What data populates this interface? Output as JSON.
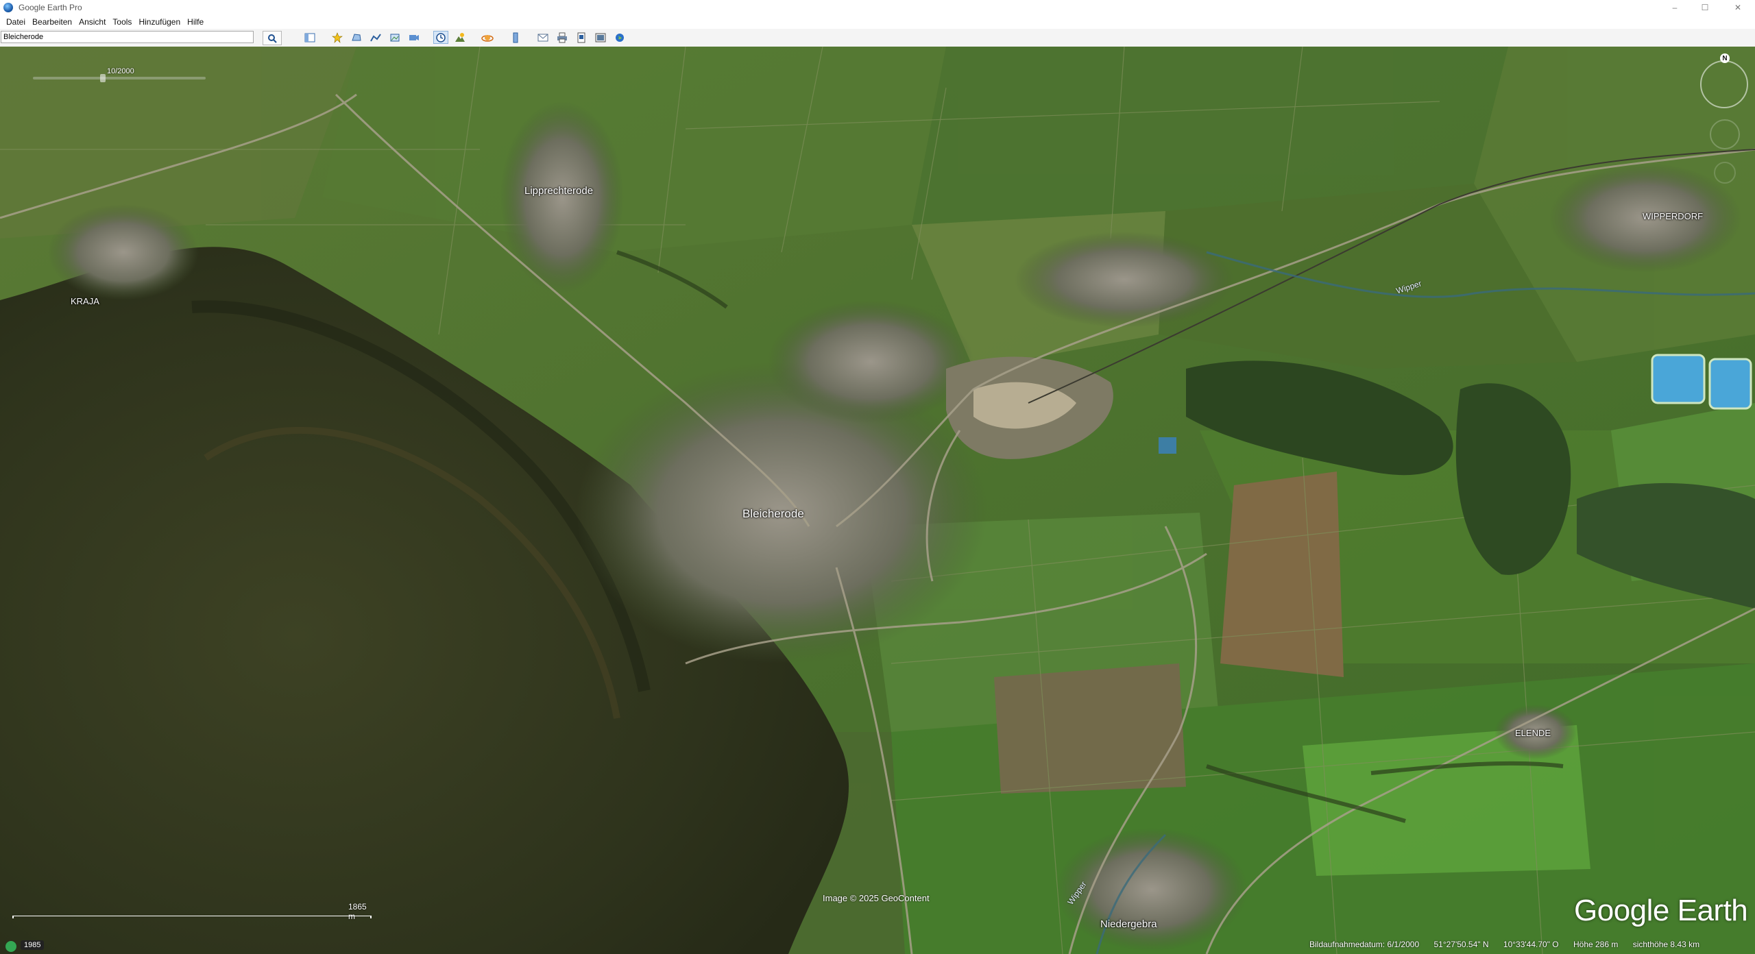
{
  "window": {
    "title": "Google Earth Pro",
    "controls": [
      "–",
      "☐",
      "✕"
    ]
  },
  "menu": [
    "Datei",
    "Bearbeiten",
    "Ansicht",
    "Tools",
    "Hinzufügen",
    "Hilfe"
  ],
  "search": {
    "value": "Bleicherode"
  },
  "toolbar": {
    "icons": [
      "sidebar-icon",
      "placemark-icon",
      "polygon-icon",
      "path-icon",
      "image-overlay-icon",
      "record-tour-icon",
      "historical-imagery-icon",
      "sun-icon",
      "planets-icon",
      "ruler-icon",
      "email-icon",
      "print-icon",
      "save-image-icon",
      "view-in-maps-icon",
      "earth-icon"
    ]
  },
  "map": {
    "zoom_label": "10/2000",
    "places": [
      {
        "name": "Lipprechterode",
        "key": "lipprechterode"
      },
      {
        "name": "KRAJA",
        "key": "kraja"
      },
      {
        "name": "Bleicherode",
        "key": "bleicherode"
      },
      {
        "name": "WIPPERDORF",
        "key": "wipperdorf"
      },
      {
        "name": "ELENDE",
        "key": "elende"
      },
      {
        "name": "Niedergebra",
        "key": "niedergebra"
      }
    ],
    "rivers": [
      "Wipper",
      "Wipper"
    ],
    "copyright": "Image © 2025 GeoContent",
    "logo": "Google Earth",
    "scale_label": "1865 m",
    "history_year": "1985"
  },
  "status": {
    "imagery_date": "Bildaufnahmedatum: 6/1/2000",
    "lat": "51°27'50.54\" N",
    "lon": "10°33'44.70\" O",
    "elevation": "Höhe  286 m",
    "eye_alt": "sichthöhe  8.43 km"
  },
  "colors": {
    "field_green": "#4f6f2c",
    "forest_dark": "#2d321c",
    "town": "#8b8a7d",
    "water": "#4aa6d8"
  }
}
